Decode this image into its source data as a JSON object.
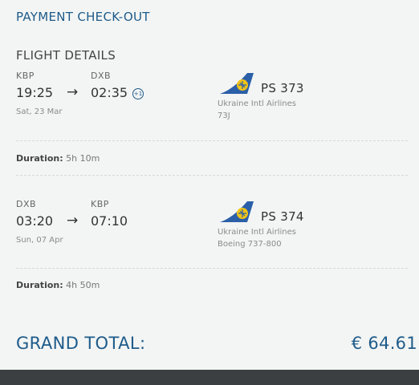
{
  "page": {
    "title": "PAYMENT CHECK-OUT"
  },
  "flight_details": {
    "title": "FLIGHT DETAILS",
    "legs": [
      {
        "from_code": "KBP",
        "to_code": "DXB",
        "depart_time": "19:25",
        "arrive_time": "02:35",
        "arrow": "→",
        "day_offset": "+1",
        "date": "Sat, 23 Mar",
        "flight_number": "PS 373",
        "airline": "Ukraine Intl Airlines",
        "aircraft": "73J",
        "duration_label": "Duration:",
        "duration_value": "5h 10m"
      },
      {
        "from_code": "DXB",
        "to_code": "KBP",
        "depart_time": "03:20",
        "arrive_time": "07:10",
        "arrow": "→",
        "date": "Sun, 07 Apr",
        "flight_number": "PS 374",
        "airline": "Ukraine Intl Airlines",
        "aircraft": "Boeing 737-800",
        "duration_label": "Duration:",
        "duration_value": "4h 50m"
      }
    ]
  },
  "total": {
    "label": "GRAND TOTAL:",
    "value": "€ 64.61"
  },
  "colors": {
    "accent": "#1e5b8a",
    "logo_blue": "#2b5fa8",
    "logo_yellow": "#f2c316",
    "bar": "#3b3f42"
  },
  "icons": {
    "airline_logo": "ukraine-airlines-logo-icon",
    "arrow": "arrow-right-icon"
  }
}
